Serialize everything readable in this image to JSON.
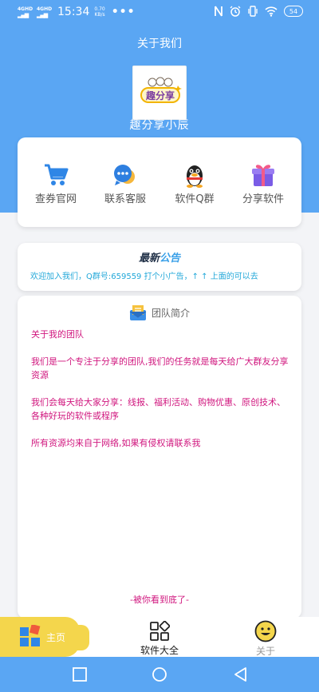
{
  "status": {
    "net1": "4GHD",
    "net2": "4GHD",
    "time": "15:34",
    "speed_value": "0.70",
    "speed_unit": "KB/s",
    "dots": "•••",
    "battery": "54"
  },
  "header": {
    "title": "关于我们",
    "app_name": "趣分享小辰",
    "logo_text": "趣分享"
  },
  "quick_links": [
    {
      "label": "查券官网",
      "icon": "cart-icon"
    },
    {
      "label": "联系客服",
      "icon": "chat-icon"
    },
    {
      "label": "软件Q群",
      "icon": "qq-penguin-icon"
    },
    {
      "label": "分享软件",
      "icon": "gift-icon"
    }
  ],
  "notice": {
    "title_a": "最新",
    "title_b": "公告",
    "text": "欢迎加入我们，Q群号:659559 打个小广告，↑ ↑ 上面的可以去"
  },
  "intro": {
    "heading": "团队简介",
    "paragraphs": [
      "关于我的团队",
      "我们是一个专注于分享的团队,我们的任务就是每天给广大群友分享资源",
      "我们会每天给大家分享：线报、福利活动、购物优惠、原创技术、各种好玩的软件或程序",
      "所有资源均来自于网络,如果有侵权请联系我"
    ],
    "bottom_note": "-被你看到底了-"
  },
  "tabs": [
    {
      "label": "主页",
      "icon": "home-grid-icon",
      "active": true
    },
    {
      "label": "软件大全",
      "icon": "apps-icon",
      "active": false
    },
    {
      "label": "关于",
      "icon": "smiley-icon",
      "active": false
    }
  ],
  "colors": {
    "primary": "#5aa6f3",
    "accent": "#f4d64c",
    "notice_text": "#23a8d9",
    "intro_text": "#d0167e"
  }
}
